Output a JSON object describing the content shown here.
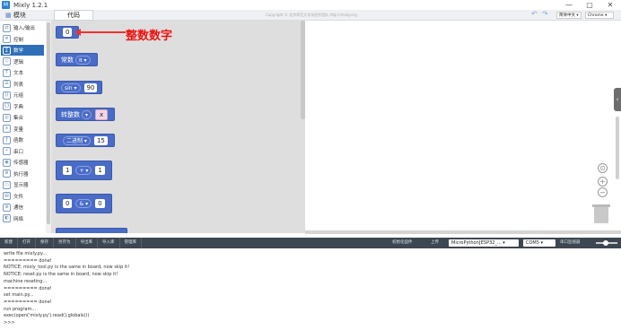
{
  "window": {
    "title": "Mixly 1.2.1",
    "logo": "M",
    "minimize": "—",
    "maximize": "▢",
    "close": "✕"
  },
  "menubar": {
    "modules_tab": "模块",
    "code_tab": "代码",
    "copyright": "Copyright © 北京师范大学米思齐团队 http://mixly.org",
    "undo": "↶",
    "redo": "↷",
    "language": "简体中文",
    "browser": "Chrome"
  },
  "categories": [
    {
      "label": "输入/输出",
      "icon": "io-icon"
    },
    {
      "label": "控制",
      "icon": "control-icon"
    },
    {
      "label": "数学",
      "icon": "math-icon"
    },
    {
      "label": "逻辑",
      "icon": "logic-icon"
    },
    {
      "label": "文本",
      "icon": "text-icon"
    },
    {
      "label": "列表",
      "icon": "list-icon"
    },
    {
      "label": "元组",
      "icon": "tuple-icon"
    },
    {
      "label": "字典",
      "icon": "dict-icon"
    },
    {
      "label": "集合",
      "icon": "set-icon"
    },
    {
      "label": "变量",
      "icon": "variable-icon"
    },
    {
      "label": "函数",
      "icon": "function-icon"
    },
    {
      "label": "串口",
      "icon": "serial-icon"
    },
    {
      "label": "传感器",
      "icon": "sensor-icon"
    },
    {
      "label": "执行器",
      "icon": "actuator-icon"
    },
    {
      "label": "显示器",
      "icon": "display-icon"
    },
    {
      "label": "文件",
      "icon": "file-icon"
    },
    {
      "label": "通信",
      "icon": "communication-icon"
    },
    {
      "label": "网络",
      "icon": "network-icon"
    }
  ],
  "active_category": "数学",
  "annotation": "整数数字",
  "blocks": {
    "number": {
      "value": "0"
    },
    "constant": {
      "label": "常数",
      "option": "π"
    },
    "trig": {
      "option": "sin",
      "value": "90"
    },
    "convert": {
      "label": "转整数",
      "arg": "x"
    },
    "binary": {
      "option": "二进制",
      "value": "15"
    },
    "arith": {
      "left": "1",
      "op": "+",
      "right": "1"
    },
    "bitwise": {
      "left": "0",
      "op": "&",
      "right": "0"
    }
  },
  "statusbar": {
    "buttons": [
      "新建",
      "打开",
      "保存",
      "另存为",
      "导出库",
      "导入库",
      "管理库"
    ],
    "init_firmware": "初始化固件",
    "upload": "上传",
    "board": "MicroPython[ESP32_...",
    "port": "COM5",
    "serial_monitor": "串口监视器"
  },
  "console": {
    "lines": [
      "write file mixly.py...",
      "========= done!",
      "NOTICE: mixly_tool.py is the same in board, now skip it!",
      "NOTICE: reset.py is the same in board, now skip it!",
      "machine reseting...",
      "========= done!",
      "set main.py...",
      "========= done!",
      "run program...",
      "exec(open('mixly.py').read(),globals())",
      ">>>"
    ]
  }
}
